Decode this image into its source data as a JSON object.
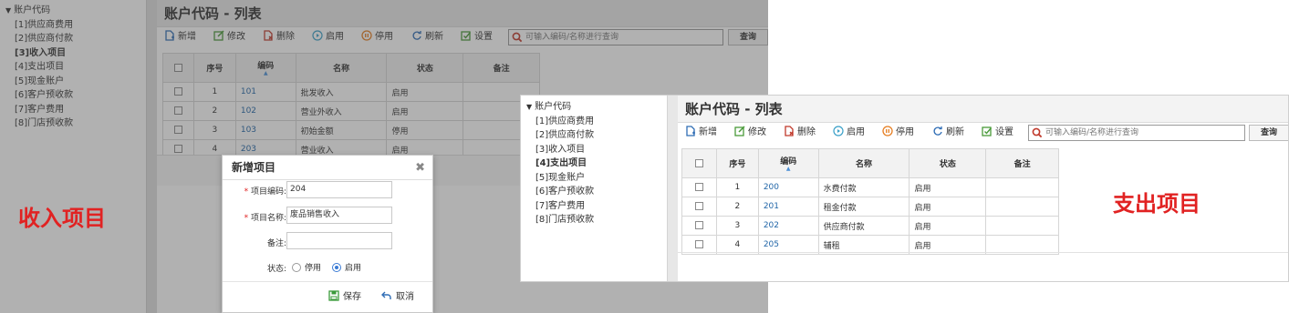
{
  "left_panel": {
    "tree": {
      "root": "账户代码",
      "items": [
        {
          "label": "[1]供应商费用",
          "selected": false
        },
        {
          "label": "[2]供应商付款",
          "selected": false
        },
        {
          "label": "[3]收入项目",
          "selected": true
        },
        {
          "label": "[4]支出项目",
          "selected": false
        },
        {
          "label": "[5]现金账户",
          "selected": false
        },
        {
          "label": "[6]客户预收款",
          "selected": false
        },
        {
          "label": "[7]客户费用",
          "selected": false
        },
        {
          "label": "[8]门店预收款",
          "selected": false
        }
      ]
    },
    "caption": "收入项目",
    "title": "账户代码 - 列表",
    "toolbar": {
      "add": "新增",
      "edit": "修改",
      "delete": "删除",
      "enable": "启用",
      "disable": "停用",
      "refresh": "刷新",
      "settings": "设置"
    },
    "search_placeholder": "可输入编码/名称进行查询",
    "query_button": "查询",
    "columns": [
      "序号",
      "编码",
      "名称",
      "状态",
      "备注"
    ],
    "rows": [
      {
        "no": "1",
        "code": "101",
        "name": "批发收入",
        "status": "启用",
        "note": ""
      },
      {
        "no": "2",
        "code": "102",
        "name": "营业外收入",
        "status": "启用",
        "note": ""
      },
      {
        "no": "3",
        "code": "103",
        "name": "初始金额",
        "status": "停用",
        "note": ""
      },
      {
        "no": "4",
        "code": "203",
        "name": "营业收入",
        "status": "启用",
        "note": ""
      }
    ]
  },
  "dialog": {
    "title": "新增项目",
    "code_label": "项目编码:",
    "code_value": "204",
    "name_label": "项目名称:",
    "name_value": "废品销售收入",
    "note_label": "备注:",
    "note_value": "",
    "status_label": "状态:",
    "status_disabled": "停用",
    "status_enabled": "启用",
    "status_selected": "启用",
    "save": "保存",
    "cancel": "取消"
  },
  "right_panel": {
    "tree": {
      "root": "账户代码",
      "items": [
        {
          "label": "[1]供应商费用",
          "selected": false
        },
        {
          "label": "[2]供应商付款",
          "selected": false
        },
        {
          "label": "[3]收入项目",
          "selected": false
        },
        {
          "label": "[4]支出项目",
          "selected": true
        },
        {
          "label": "[5]现金账户",
          "selected": false
        },
        {
          "label": "[6]客户预收款",
          "selected": false
        },
        {
          "label": "[7]客户费用",
          "selected": false
        },
        {
          "label": "[8]门店预收款",
          "selected": false
        }
      ]
    },
    "caption": "支出项目",
    "title": "账户代码 - 列表",
    "toolbar": {
      "add": "新增",
      "edit": "修改",
      "delete": "删除",
      "enable": "启用",
      "disable": "停用",
      "refresh": "刷新",
      "settings": "设置"
    },
    "search_placeholder": "可输入编码/名称进行查询",
    "query_button": "查询",
    "columns": [
      "序号",
      "编码",
      "名称",
      "状态",
      "备注"
    ],
    "rows": [
      {
        "no": "1",
        "code": "200",
        "name": "水费付款",
        "status": "启用",
        "note": ""
      },
      {
        "no": "2",
        "code": "201",
        "name": "租金付款",
        "status": "启用",
        "note": ""
      },
      {
        "no": "3",
        "code": "202",
        "name": "供应商付款",
        "status": "启用",
        "note": ""
      },
      {
        "no": "4",
        "code": "205",
        "name": "辅租",
        "status": "启用",
        "note": ""
      }
    ]
  },
  "colors": {
    "link": "#2266a8",
    "caption_red": "#e12222",
    "overlay": "#a8a8a8",
    "radio_blue": "#3a7bd5"
  },
  "icons": [
    "add-icon",
    "edit-icon",
    "delete-icon",
    "enable-icon",
    "disable-icon",
    "refresh-icon",
    "settings-icon",
    "search-icon",
    "close-icon",
    "save-icon",
    "cancel-icon"
  ]
}
